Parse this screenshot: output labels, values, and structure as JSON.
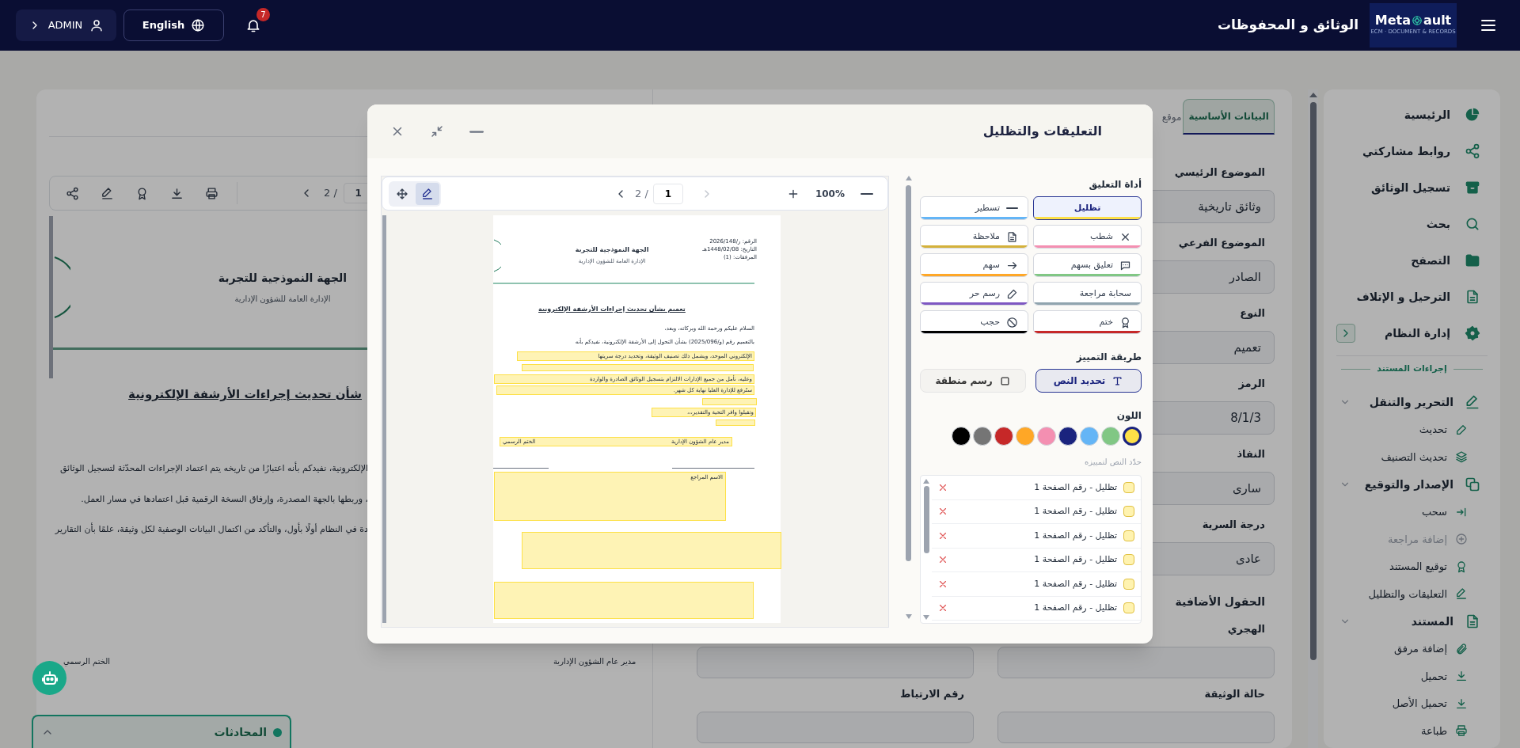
{
  "topbar": {
    "user": "ADMIN",
    "language": "English",
    "notification_count": "7",
    "app_title": "الوثائق و المحفوظات",
    "logo": {
      "left": "Meta",
      "right": "ault",
      "tagline": "ECM · DOCUMENT & RECORDS"
    }
  },
  "sidebar": {
    "items": [
      {
        "label": "الرئيسية"
      },
      {
        "label": "روابط مشاركتي"
      },
      {
        "label": "تسجيل الوثائق"
      },
      {
        "label": "بحث"
      },
      {
        "label": "التصفح"
      },
      {
        "label": "الترحيل و الإتلاف"
      },
      {
        "label": "إدارة النظام"
      }
    ],
    "section_label": "إجراءات المستند",
    "groups": [
      {
        "label": "التحرير والتنقل",
        "expanded": true,
        "children": [
          {
            "label": "تحديث",
            "disabled": false
          },
          {
            "label": "تحديث التصنيف",
            "disabled": false
          }
        ]
      },
      {
        "label": "الإصدار والتوقيع",
        "expanded": true,
        "children": [
          {
            "label": "سحب",
            "disabled": false
          },
          {
            "label": "إضافة مراجعة",
            "disabled": true
          },
          {
            "label": "توقيع المستند",
            "disabled": false
          },
          {
            "label": "التعليقات والتظليل",
            "disabled": false
          }
        ]
      },
      {
        "label": "المستند",
        "expanded": true,
        "children": [
          {
            "label": "إضافة مرفق",
            "disabled": false
          },
          {
            "label": "تحميل",
            "disabled": false
          },
          {
            "label": "تحميل الأصل",
            "disabled": false
          },
          {
            "label": "طباعة",
            "disabled": false
          }
        ]
      }
    ]
  },
  "document_preview": {
    "page_total": "2 /",
    "page_input": "1",
    "organization": "الجهة النموذجية للتجربة",
    "department": "الإدارة العامة للشؤون الإدارية",
    "title": "شأن تحديث إجراءات الأرشفة الإلكترونية",
    "lines": [
      "الإلكترونية، نفيدكم بأنه اعتبارًا من تاريخه يتم اعتماد الإجراءات المحدّثة لتسجيل الوثائق",
      "، وربطها بالجهة المصدرة، وإرفاق النسخة الرقمية قبل اعتمادها في مسار العمل.",
      "دة في النظام أولًا بأول، والتأكد من اكتمال البيانات الوصفية لكل وثيقة، علمًا بأن التقارير"
    ],
    "signatures": [
      "مدير عام الشؤون الإدارية",
      "الختم الرسمي"
    ]
  },
  "chat": {
    "label": "المحادثات"
  },
  "details": {
    "tabs": [
      {
        "label": "البيانات الأساسية",
        "selected": true
      },
      {
        "label": "موقع",
        "selected": false
      }
    ],
    "fields": [
      {
        "label": "الموضوع الرئيسي",
        "value": "وثائق تاريخية"
      },
      {
        "label": "الموضوع الفرعي",
        "value": "الصادر"
      },
      {
        "label": "النوع",
        "value": "تعميم"
      },
      {
        "label": "الرمز",
        "value": "8/1/3"
      },
      {
        "label": "النفاذ",
        "value": "سارى"
      },
      {
        "label": "درجة السرية",
        "value": "عادى"
      }
    ],
    "extra_title": "الحقول الأضافية",
    "extra_fields": [
      {
        "kind": "text",
        "label": "الهجري"
      },
      {
        "kind": "text"
      },
      {
        "kind": "text",
        "label": "حالة الوثيقة"
      },
      {
        "kind": "text",
        "label": "رقم الارتباط"
      }
    ]
  },
  "modal": {
    "title": "التعليقات والتظليل",
    "viewer": {
      "modes": [
        {
          "kind": "pan",
          "selected": false
        },
        {
          "kind": "annotate",
          "selected": true
        }
      ],
      "page_total": "2 /",
      "page_input": "1",
      "zoom": "100%",
      "page": {
        "ref_lines": [
          "الرقم: ر/2026/148",
          "التاريخ: 1448/02/08هـ",
          "المرفقات: (1)"
        ],
        "organization": "الجهة النموذجية للتجربة",
        "department": "الإدارة العامة للشؤون الإدارية",
        "title": "تعميم بشأن تحديث إجراءات الأرشفة الإلكترونية",
        "greeting": "السلام عليكم ورحمة الله وبركاته، وبعد،",
        "lines": [
          "بالتعميم رقم (و/2025/096) بشأن التحول إلى الأرشفة الإلكترونية، نفيدكم بأنه",
          "الإلكتروني الموحد، ويشمل ذلك تصنيف الوثيقة، وتحديد درجة سريتها",
          "وعليه، نأمل من جميع الإدارات الالتزام بتسجيل الوثائق الصادرة والواردة",
          "ستُرفع للإدارة العليا نهاية كل شهر."
        ],
        "closing": "وتقبلوا وافر التحية والتقدير،،،",
        "signatures": [
          "مدير عام الشؤون الإدارية",
          "الختم الرسمي"
        ],
        "note": "الاسم المراجع"
      }
    },
    "tool_label": "أداة التعليق",
    "tools": [
      {
        "label": "تظليل",
        "kind": "highlight",
        "color": "#fde047",
        "selected": true
      },
      {
        "label": "تسطير",
        "kind": "underline",
        "color": "#64b5f6",
        "selected": false
      },
      {
        "label": "شطب",
        "kind": "strike",
        "color": "#f48fb1",
        "selected": false
      },
      {
        "label": "ملاحظة",
        "kind": "note",
        "color": "#d4b13a",
        "selected": false
      },
      {
        "label": "تعليق بسهم",
        "kind": "callout",
        "color": "#81c784",
        "selected": false
      },
      {
        "label": "سهم",
        "kind": "arrow",
        "color": "#ffa726",
        "selected": false
      },
      {
        "label": "سحابة مراجعة",
        "kind": "cloud",
        "color": "#90a4ae",
        "selected": false
      },
      {
        "label": "رسم حر",
        "kind": "freehand",
        "color": "#7e57c2",
        "selected": false
      },
      {
        "label": "ختم",
        "kind": "stamp",
        "color": "#c62828",
        "selected": false
      },
      {
        "label": "حجب",
        "kind": "redact",
        "color": "#000000",
        "selected": false
      }
    ],
    "method_label": "طريقة التمييز",
    "methods": [
      {
        "label": "تحديد النص",
        "kind": "text",
        "selected": true
      },
      {
        "label": "رسم منطقة",
        "kind": "area",
        "selected": false
      }
    ],
    "color_label": "اللون",
    "colors": [
      {
        "color": "#fde047",
        "selected": true
      },
      {
        "color": "#81c784",
        "selected": false
      },
      {
        "color": "#64b5f6",
        "selected": false
      },
      {
        "color": "#1a237e",
        "selected": false
      },
      {
        "color": "#f48fb1",
        "selected": false
      },
      {
        "color": "#ffa726",
        "selected": false
      },
      {
        "color": "#c62828",
        "selected": false
      },
      {
        "color": "#757575",
        "selected": false
      },
      {
        "color": "#000000",
        "selected": false
      }
    ],
    "hint": "حدّد النص لتمييزه",
    "annotations": [
      {
        "label": "تظليل - رقم الصفحة 1"
      },
      {
        "label": "تظليل - رقم الصفحة 1"
      },
      {
        "label": "تظليل - رقم الصفحة 1"
      },
      {
        "label": "تظليل - رقم الصفحة 1"
      },
      {
        "label": "تظليل - رقم الصفحة 1"
      },
      {
        "label": "تظليل - رقم الصفحة 1"
      }
    ]
  }
}
